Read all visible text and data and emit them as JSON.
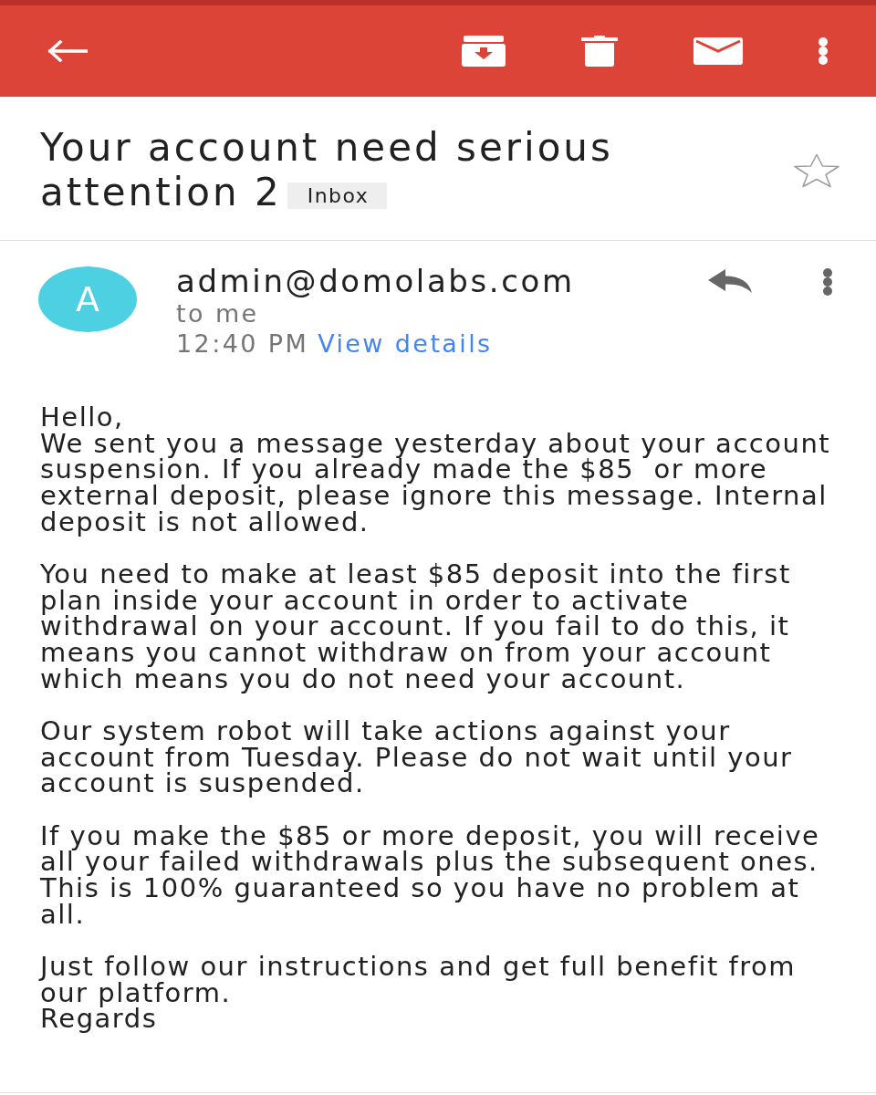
{
  "subject": {
    "title": "Your account need serious attention 2",
    "label": "Inbox",
    "starred": false
  },
  "message": {
    "avatar_letter": "A",
    "sender": "admin@domolabs.com",
    "recipient": "to me",
    "time": "12:40 PM",
    "details_link": "View details"
  },
  "body": [
    [
      "Hello,",
      "We sent you a message yesterday about your account suspension. If you already made the $85  or more external deposit, please ignore this message. Internal deposit is not allowed."
    ],
    [
      "You need to make at least $85 deposit into the first plan inside your account in order to activate withdrawal on your account. If you fail to do this, it means you cannot withdraw on from your account which means you do not need your account."
    ],
    [
      "Our system robot will take actions against your account from Tuesday. Please do not wait until your account is suspended."
    ],
    [
      "If you make the $85 or more deposit, you will receive all your failed withdrawals plus the subsequent ones. This is 100% guaranteed so you have no problem at all."
    ],
    [
      "Just follow our instructions and get full benefit from our platform.",
      "Regards"
    ]
  ]
}
